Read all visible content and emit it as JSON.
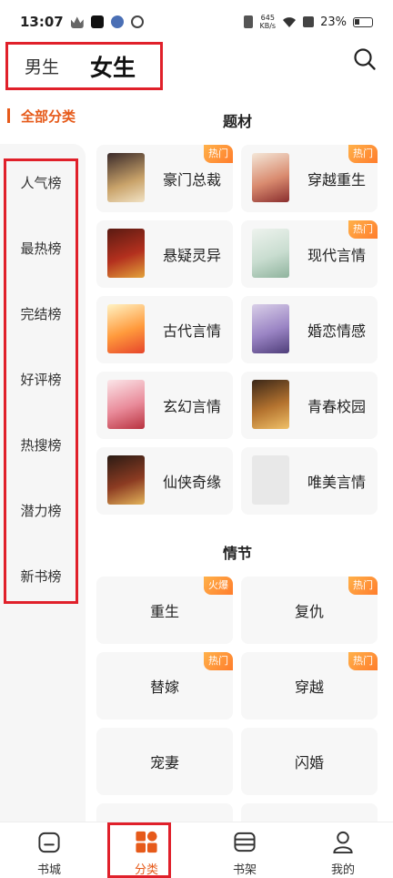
{
  "status_bar": {
    "time": "13:07",
    "speed_top": "645",
    "speed_bottom": "KB/s",
    "battery": "23%"
  },
  "header": {
    "tabs": [
      {
        "label": "男生",
        "active": false
      },
      {
        "label": "女生",
        "active": true
      }
    ],
    "search_icon": "search-icon"
  },
  "sidebar": {
    "title": "全部分类",
    "items": [
      "人气榜",
      "最热榜",
      "完结榜",
      "好评榜",
      "热搜榜",
      "潜力榜",
      "新书榜"
    ]
  },
  "sections": {
    "theme_title": "题材",
    "theme_items": [
      {
        "label": "豪门总裁",
        "badge": "热门"
      },
      {
        "label": "穿越重生",
        "badge": "热门"
      },
      {
        "label": "悬疑灵异",
        "badge": ""
      },
      {
        "label": "现代言情",
        "badge": "热门"
      },
      {
        "label": "古代言情",
        "badge": ""
      },
      {
        "label": "婚恋情感",
        "badge": ""
      },
      {
        "label": "玄幻言情",
        "badge": ""
      },
      {
        "label": "青春校园",
        "badge": ""
      },
      {
        "label": "仙侠奇缘",
        "badge": ""
      },
      {
        "label": "唯美言情",
        "badge": ""
      }
    ],
    "plot_title": "情节",
    "plot_items": [
      {
        "label": "重生",
        "badge": "火爆"
      },
      {
        "label": "复仇",
        "badge": "热门"
      },
      {
        "label": "替嫁",
        "badge": "热门"
      },
      {
        "label": "穿越",
        "badge": "热门"
      },
      {
        "label": "宠妻",
        "badge": ""
      },
      {
        "label": "闪婚",
        "badge": ""
      }
    ]
  },
  "bottom_nav": [
    {
      "label": "书城",
      "icon": "bookstore-icon",
      "active": false
    },
    {
      "label": "分类",
      "icon": "category-icon",
      "active": true
    },
    {
      "label": "书架",
      "icon": "bookshelf-icon",
      "active": false
    },
    {
      "label": "我的",
      "icon": "profile-icon",
      "active": false
    }
  ],
  "colors": {
    "accent": "#e65a1a",
    "highlight_box": "#e0202a",
    "badge": "#ff8a33"
  }
}
